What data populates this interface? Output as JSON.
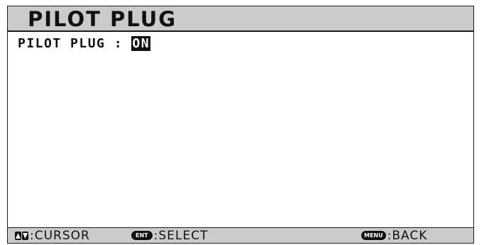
{
  "title": "PILOT PLUG",
  "setting": {
    "label": "PILOT PLUG :",
    "value": "ON"
  },
  "footer": {
    "cursor_label": ":CURSOR",
    "select_key": "ENT",
    "select_label": ":SELECT",
    "back_key": "MENU",
    "back_label": ":BACK"
  },
  "icons": {
    "cursor": "up-down-arrows-icon",
    "select": "ent-key-icon",
    "back": "menu-key-icon"
  }
}
